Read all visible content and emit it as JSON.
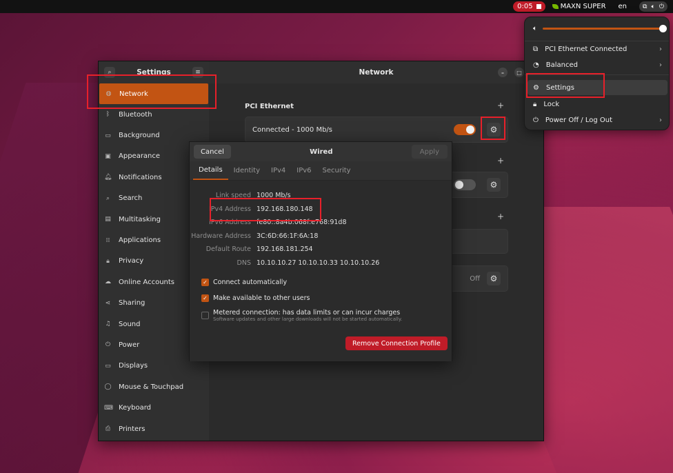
{
  "topbar": {
    "recording_time": "0:05",
    "gpu_label": "MAXN SUPER",
    "language": "en"
  },
  "sidebar": {
    "title": "Settings",
    "items": [
      {
        "label": "Network",
        "icon": "network-icon",
        "active": true
      },
      {
        "label": "Bluetooth",
        "icon": "bluetooth-icon"
      },
      {
        "label": "Background",
        "icon": "background-icon"
      },
      {
        "label": "Appearance",
        "icon": "appearance-icon"
      },
      {
        "label": "Notifications",
        "icon": "bell-icon"
      },
      {
        "label": "Search",
        "icon": "search-icon"
      },
      {
        "label": "Multitasking",
        "icon": "multitasking-icon"
      },
      {
        "label": "Applications",
        "icon": "grid-icon"
      },
      {
        "label": "Privacy",
        "icon": "lock-icon"
      },
      {
        "label": "Online Accounts",
        "icon": "cloud-icon"
      },
      {
        "label": "Sharing",
        "icon": "share-icon"
      },
      {
        "label": "Sound",
        "icon": "music-note-icon"
      },
      {
        "label": "Power",
        "icon": "power-icon"
      },
      {
        "label": "Displays",
        "icon": "display-icon"
      },
      {
        "label": "Mouse & Touchpad",
        "icon": "mouse-icon"
      },
      {
        "label": "Keyboard",
        "icon": "keyboard-icon"
      },
      {
        "label": "Printers",
        "icon": "printer-icon"
      }
    ]
  },
  "main": {
    "title": "Network",
    "section_title": "PCI Ethernet",
    "ethernet_status": "Connected - 1000 Mb/s",
    "off_label": "Off"
  },
  "dialog": {
    "cancel": "Cancel",
    "title": "Wired",
    "apply": "Apply",
    "tabs": [
      "Details",
      "Identity",
      "IPv4",
      "IPv6",
      "Security"
    ],
    "details": [
      {
        "key": "Link speed",
        "value": "1000 Mb/s"
      },
      {
        "key": "IPv4 Address",
        "value": "192.168.180.148"
      },
      {
        "key": "IPv6 Address",
        "value": "fe80::8a4b:068f:e768:91d8"
      },
      {
        "key": "Hardware Address",
        "value": "3C:6D:66:1F:6A:18"
      },
      {
        "key": "Default Route",
        "value": "192.168.181.254"
      },
      {
        "key": "DNS",
        "value": "10.10.10.27 10.10.10.33 10.10.10.26"
      }
    ],
    "connect_auto": "Connect automatically",
    "available_all": "Make available to other users",
    "metered": "Metered connection: has data limits or can incur charges",
    "metered_sub": "Software updates and other large downloads will not be started automatically.",
    "remove": "Remove Connection Profile"
  },
  "menu": {
    "items": [
      {
        "label": "PCI Ethernet Connected",
        "icon": "network-icon",
        "chevron": true
      },
      {
        "label": "Balanced",
        "icon": "power-profile-icon",
        "chevron": true
      },
      {
        "label": "Settings",
        "icon": "gear-icon",
        "chevron": false
      },
      {
        "label": "Lock",
        "icon": "lock-icon",
        "chevron": false
      },
      {
        "label": "Power Off / Log Out",
        "icon": "power-icon",
        "chevron": true
      }
    ]
  },
  "colors": {
    "accent": "#c25413",
    "destructive": "#c01c28",
    "annotation": "#e8202a"
  }
}
